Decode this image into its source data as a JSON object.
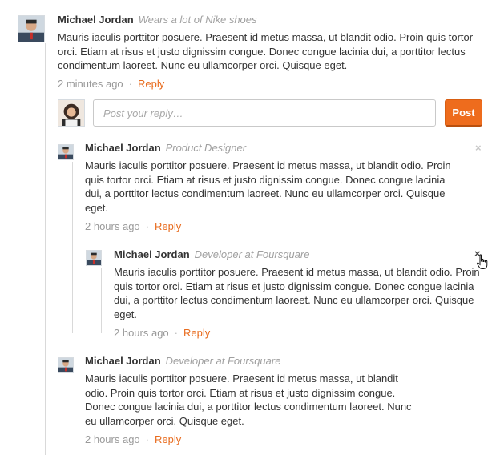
{
  "top_comment": {
    "author": "Michael Jordan",
    "role": "Wears a lot of Nike shoes",
    "text": "Mauris iaculis porttitor posuere. Praesent id metus massa, ut blandit odio. Proin quis tortor orci. Etiam at risus et justo dignissim congue. Donec congue lacinia dui, a porttitor lectus condimentum laoreet. Nunc eu ullamcorper orci. Quisque eget.",
    "time": "2 minutes ago",
    "reply_label": "Reply",
    "separator": "·"
  },
  "reply_box": {
    "placeholder": "Post your reply…",
    "post_label": "Post"
  },
  "replies": [
    {
      "author": "Michael Jordan",
      "role": "Product Designer",
      "text": "Mauris iaculis porttitor posuere. Praesent id metus massa, ut blandit odio. Proin quis tortor orci. Etiam at risus et justo dignissim congue. Donec congue lacinia dui, a porttitor lectus condimentum laoreet. Nunc eu ullamcorper orci. Quisque eget.",
      "time": "2 hours ago",
      "reply_label": "Reply",
      "close_glyph": "×"
    },
    {
      "author": "Michael Jordan",
      "role": "Developer at Foursquare",
      "text": "Mauris iaculis porttitor posuere. Praesent id metus massa, ut blandit odio. Proin quis tortor orci. Etiam at risus et justo dignissim congue. Donec congue lacinia dui, a porttitor lectus condimentum laoreet. Nunc eu ullamcorper orci. Quisque eget.",
      "time": "2 hours ago",
      "reply_label": "Reply",
      "close_glyph": "×"
    },
    {
      "author": "Michael Jordan",
      "role": "Developer at Foursquare",
      "text": "Mauris iaculis porttitor posuere. Praesent id metus massa, ut blandit odio. Proin quis tortor orci. Etiam at risus et justo dignissim congue. Donec congue lacinia dui, a porttitor lectus condimentum laoreet. Nunc eu ullamcorper orci. Quisque eget.",
      "time": "2 hours ago",
      "reply_label": "Reply"
    }
  ],
  "colors": {
    "accent": "#ee6c1d",
    "reply_link": "#e86c1f",
    "role_text": "#a0a0a0",
    "thread_line": "#d9d9d9"
  },
  "icons": {
    "author_avatar": "user-avatar-icon",
    "commenter_avatar": "user-avatar-icon",
    "close": "close-icon",
    "cursor": "hand-pointer-icon"
  }
}
